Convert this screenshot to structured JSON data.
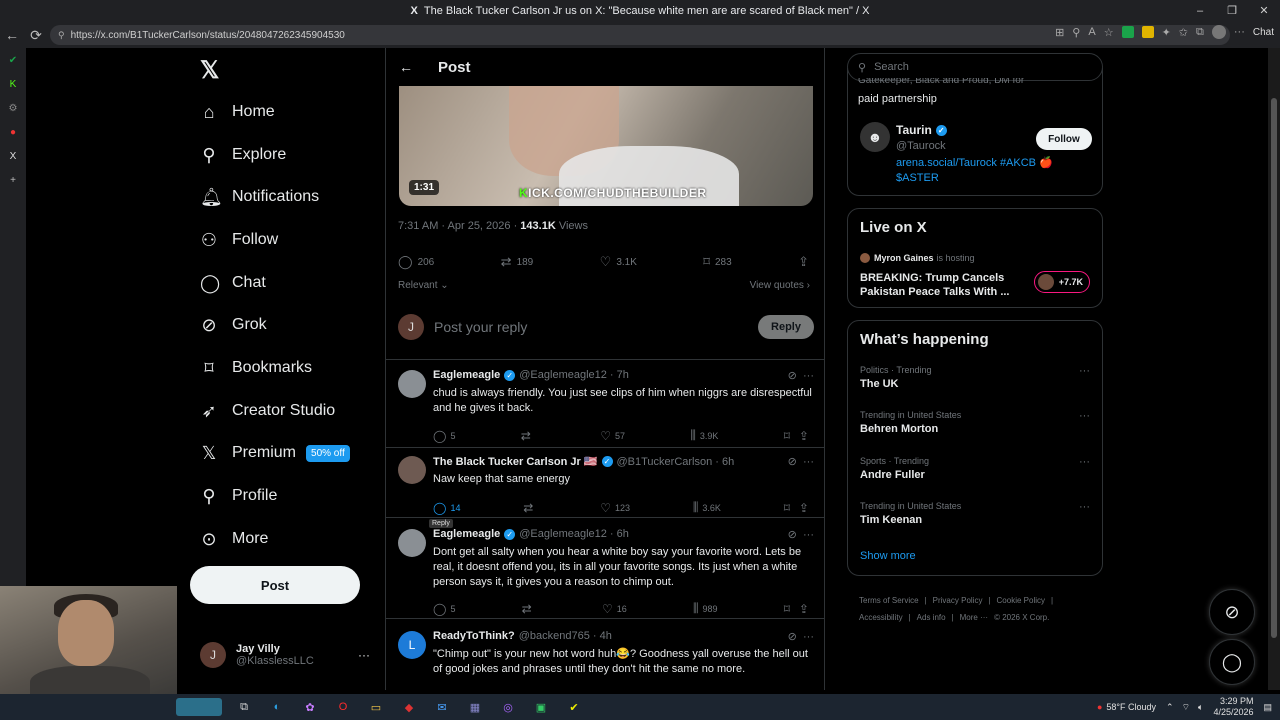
{
  "browser": {
    "window_title": "The Black Tucker Carlson Jr us on X: \"Because white men are are scared of Black men\" / X",
    "tab_icon": "X",
    "url": "https://x.com/B1TuckerCarlson/status/2048047262345904530",
    "chat_label": "Chat"
  },
  "nav": {
    "items": [
      {
        "label": "Home",
        "icon": "home-icon"
      },
      {
        "label": "Explore",
        "icon": "search-icon"
      },
      {
        "label": "Notifications",
        "icon": "bell-icon"
      },
      {
        "label": "Follow",
        "icon": "person-plus-icon"
      },
      {
        "label": "Chat",
        "icon": "chat-bubble-icon"
      },
      {
        "label": "Grok",
        "icon": "grok-icon"
      },
      {
        "label": "Bookmarks",
        "icon": "bookmark-icon"
      },
      {
        "label": "Creator Studio",
        "icon": "rocket-icon"
      },
      {
        "label": "Premium",
        "icon": "x-logo-icon"
      },
      {
        "label": "Profile",
        "icon": "person-icon"
      },
      {
        "label": "More",
        "icon": "more-circle-icon"
      }
    ],
    "premium_badge": "50% off",
    "post_button": "Post",
    "account": {
      "name": "Jay Villy",
      "handle": "@KlasslessLLC",
      "initial": "J"
    }
  },
  "post": {
    "header_title": "Post",
    "video_duration": "1:31",
    "video_overlay_k": "K",
    "video_overlay_text": "ICK.COM/CHUDTHEBUILDER",
    "timestamp": "7:31 AM · Apr 25, 2026 · ",
    "views_count": "143.1K",
    "views_label": " Views",
    "stats": {
      "replies": "206",
      "reposts": "189",
      "likes": "3.1K",
      "bookmarks": "283"
    },
    "sort_label": "Relevant",
    "view_quotes": "View quotes",
    "reply_placeholder": "Post your reply",
    "reply_button": "Reply",
    "reply_avatar_initial": "J"
  },
  "replies": [
    {
      "name": "Eaglemeagle",
      "handle": "@Eaglemeagle12 · 7h",
      "verified": true,
      "text": "chud is always friendly. You just see clips of him when niggrs are disrespectful and he gives it back.",
      "replies": "5",
      "reposts": "",
      "likes": "57",
      "views": "3.9K",
      "avatar_color": "#8a8f94"
    },
    {
      "name": "The Black Tucker Carlson Jr 🇺🇸",
      "handle": "@B1TuckerCarlson · 6h",
      "verified": true,
      "text": "Naw keep that same energy",
      "replies": "14",
      "reposts": "",
      "likes": "123",
      "views": "3.6K",
      "avatar_color": "#6e5a52"
    },
    {
      "name": "Eaglemeagle",
      "handle": "@Eaglemeagle12 · 6h",
      "verified": true,
      "text": "Dont get all salty when you hear a white boy say your favorite word. Lets be real, it doesnt offend you, its in all your favorite songs. Its just when a white person says it, it gives you a reason to chimp out.",
      "replies": "5",
      "reposts": "",
      "likes": "16",
      "views": "989",
      "avatar_color": "#8a8f94"
    },
    {
      "name": "ReadyToThink?",
      "handle": "@backend765 · 4h",
      "verified": false,
      "text": "\"Chimp out\" is your new hot word huh😂? Goodness yall overuse the hell out of good jokes and phrases until they don't hit the same no more.",
      "replies": "",
      "reposts": "",
      "likes": "",
      "views": "",
      "avatar_color": "#1d7bd8",
      "avatar_initial": "L"
    }
  ],
  "tooltip": "Reply",
  "right": {
    "search_placeholder": "Search",
    "promo_top": "paid partnership",
    "promo_top_cut": "Gatekeeper, Black and Proud, DM for",
    "promo": {
      "name": "Taurin",
      "handle": "@Taurock",
      "bio": "arena.social/Taurock #AKCB 🍎 $ASTER",
      "follow": "Follow"
    },
    "live": {
      "title": "Live on X",
      "host": "Myron Gaines",
      "host_suffix": "is hosting",
      "stream_title": "BREAKING: Trump Cancels Pakistan Peace Talks With ...",
      "count": "+7.7K"
    },
    "happening": {
      "title": "What’s happening",
      "trends": [
        {
          "category": "Politics · Trending",
          "topic": "The UK"
        },
        {
          "category": "Trending in United States",
          "topic": "Behren Morton"
        },
        {
          "category": "Sports · Trending",
          "topic": "Andre Fuller"
        },
        {
          "category": "Trending in United States",
          "topic": "Tim Keenan"
        }
      ],
      "show_more": "Show more"
    },
    "footer": [
      "Terms of Service",
      "|",
      "Privacy Policy",
      "|",
      "Cookie Policy",
      "|",
      "Accessibility",
      "|",
      "Ads info",
      "|",
      "More ···",
      "© 2026 X Corp."
    ]
  },
  "taskbar": {
    "weather": "58°F  Cloudy",
    "time": "3:29 PM",
    "date": "4/25/2026"
  }
}
